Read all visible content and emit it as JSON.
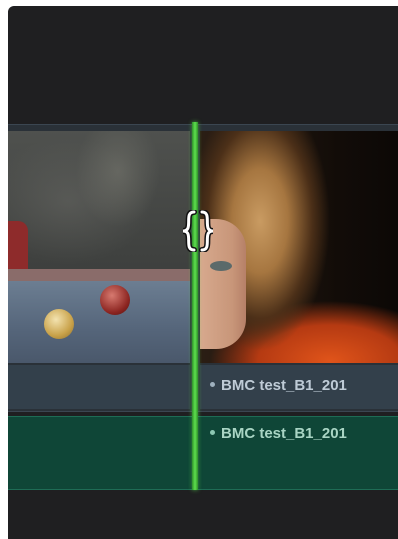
{
  "timeline": {
    "video_track": {
      "clips": [
        {
          "label": ""
        },
        {
          "label": "BMC test_B1_201"
        }
      ]
    },
    "audio_track": {
      "clips": [
        {
          "label": ""
        },
        {
          "label": "BMC test_B1_201"
        }
      ]
    },
    "playhead_color": "#4fd13d",
    "edit_point_icon": "roll-trim-icon"
  }
}
